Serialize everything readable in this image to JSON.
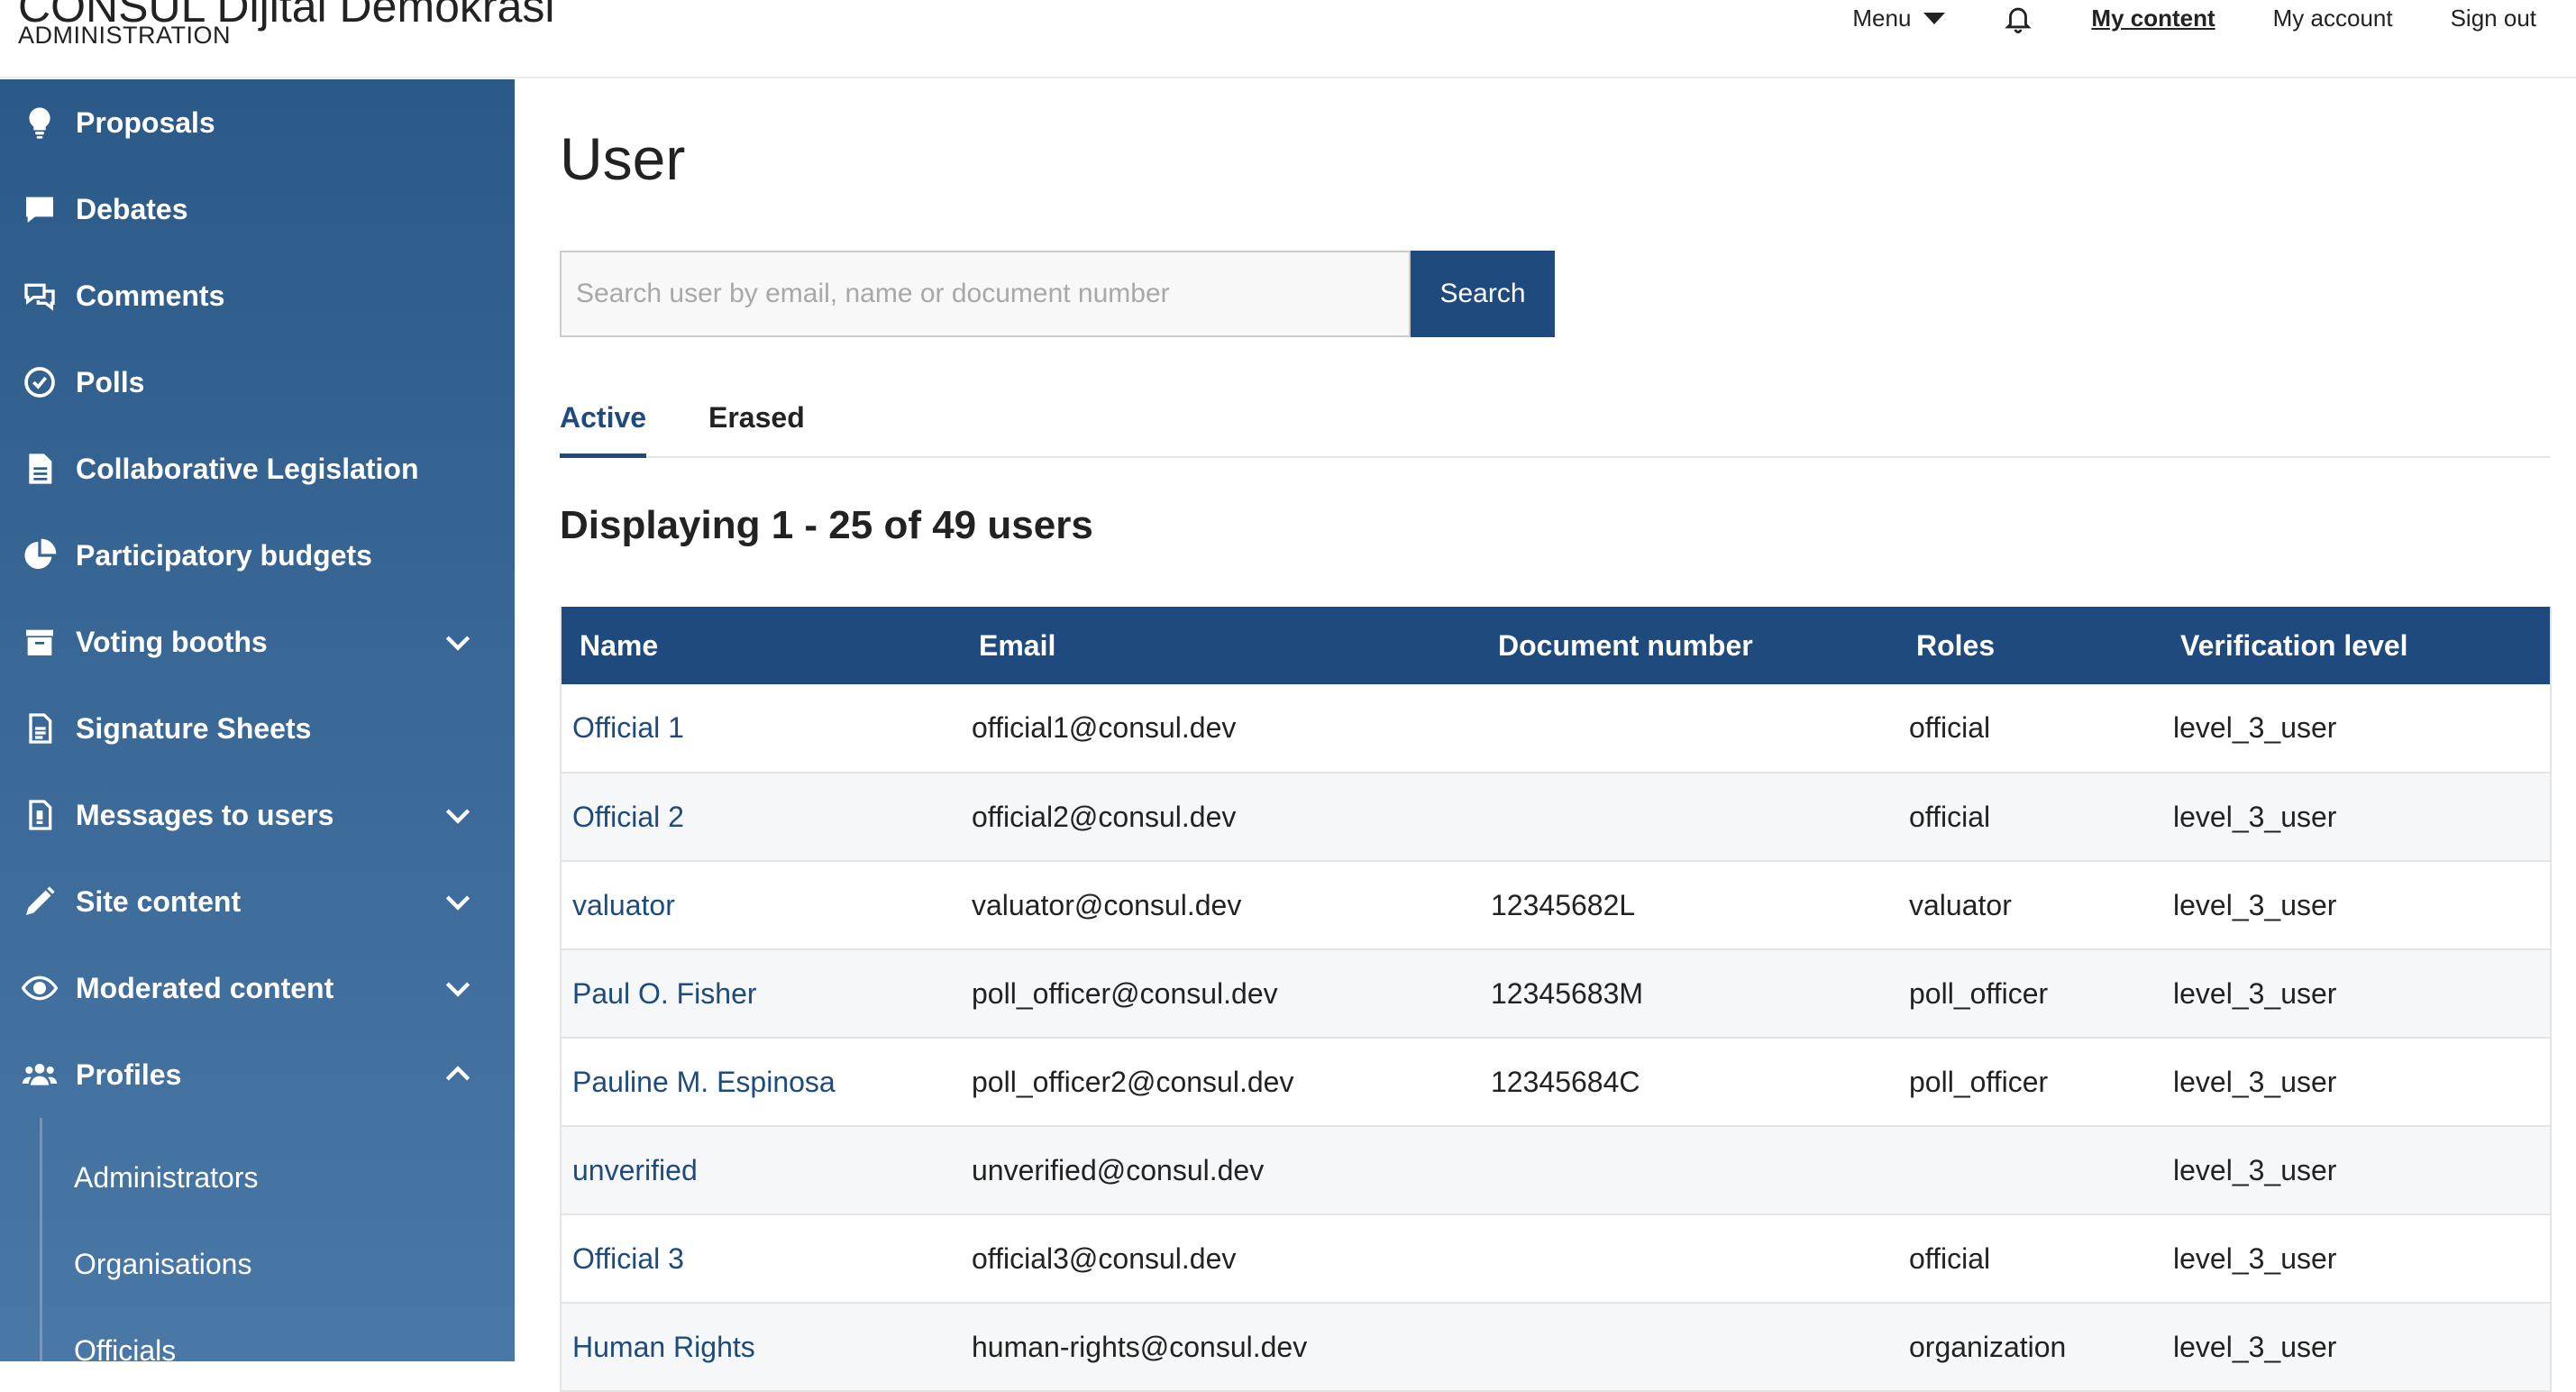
{
  "header": {
    "brand_title": "CONSUL Dijital Demokrasi",
    "brand_subtitle": "ADMINISTRATION",
    "nav": {
      "menu_label": "Menu",
      "my_content": "My content",
      "my_account": "My account",
      "sign_out": "Sign out"
    },
    "icons": {
      "menu_caret": "chevron-down-icon",
      "notifications": "bell-icon"
    }
  },
  "sidebar": {
    "items": [
      {
        "label": "Proposals",
        "icon": "lightbulb-icon",
        "chevron": ""
      },
      {
        "label": "Debates",
        "icon": "speech-bubble-icon",
        "chevron": ""
      },
      {
        "label": "Comments",
        "icon": "comments-icon",
        "chevron": ""
      },
      {
        "label": "Polls",
        "icon": "check-circle-icon",
        "chevron": ""
      },
      {
        "label": "Collaborative Legislation",
        "icon": "document-icon",
        "chevron": ""
      },
      {
        "label": "Participatory budgets",
        "icon": "pie-chart-icon",
        "chevron": ""
      },
      {
        "label": "Voting booths",
        "icon": "ballot-box-icon",
        "chevron": "down"
      },
      {
        "label": "Signature Sheets",
        "icon": "sheet-icon",
        "chevron": ""
      },
      {
        "label": "Messages to users",
        "icon": "message-document-icon",
        "chevron": "down"
      },
      {
        "label": "Site content",
        "icon": "pencil-icon",
        "chevron": "down"
      },
      {
        "label": "Moderated content",
        "icon": "eye-icon",
        "chevron": "down"
      },
      {
        "label": "Profiles",
        "icon": "users-icon",
        "chevron": "up"
      }
    ],
    "subitems": [
      "Administrators",
      "Organisations",
      "Officials"
    ]
  },
  "main": {
    "title": "User",
    "search": {
      "placeholder": "Search user by email, name or document number",
      "value": "",
      "button_label": "Search"
    },
    "tabs": [
      {
        "label": "Active",
        "active": true
      },
      {
        "label": "Erased",
        "active": false
      }
    ],
    "count_text": "Displaying 1 - 25 of 49 users",
    "table": {
      "columns": [
        "Name",
        "Email",
        "Document number",
        "Roles",
        "Verification level"
      ],
      "rows": [
        [
          "Official 1",
          "official1@consul.dev",
          "",
          "official",
          "level_3_user"
        ],
        [
          "Official 2",
          "official2@consul.dev",
          "",
          "official",
          "level_3_user"
        ],
        [
          "valuator",
          "valuator@consul.dev",
          "12345682L",
          "valuator",
          "level_3_user"
        ],
        [
          "Paul O. Fisher",
          "poll_officer@consul.dev",
          "12345683M",
          "poll_officer",
          "level_3_user"
        ],
        [
          "Pauline M. Espinosa",
          "poll_officer2@consul.dev",
          "12345684C",
          "poll_officer",
          "level_3_user"
        ],
        [
          "unverified",
          "unverified@consul.dev",
          "",
          "",
          "level_3_user"
        ],
        [
          "Official 3",
          "official3@consul.dev",
          "",
          "official",
          "level_3_user"
        ],
        [
          "Human Rights",
          "human-rights@consul.dev",
          "",
          "organization",
          "level_3_user"
        ]
      ]
    }
  },
  "colors": {
    "primary": "#1e4a7d",
    "sidebar_top": "#2c5a88",
    "sidebar_bottom": "#4a78a6",
    "row_alt": "#f6f7f8"
  }
}
